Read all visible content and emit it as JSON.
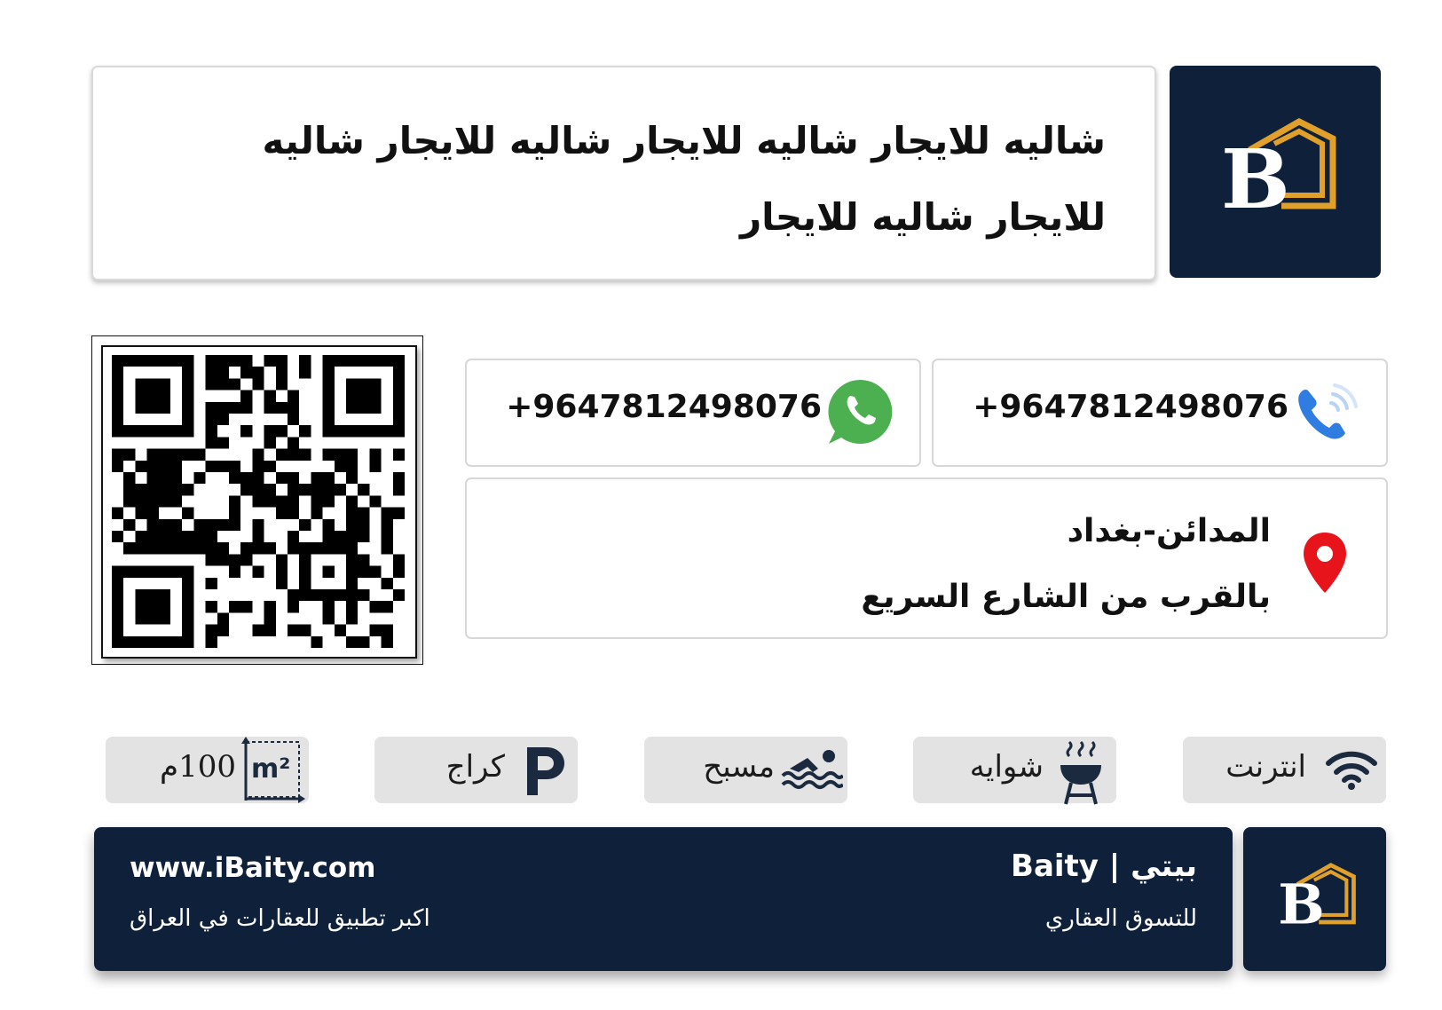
{
  "listing": {
    "title": "شاليه للايجار شاليه للايجار شاليه للايجار شاليه للايجار شاليه للايجار"
  },
  "contact": {
    "phone": "+9647812498076",
    "whatsapp": "+9647812498076"
  },
  "address": {
    "line1": "المدائن-بغداد",
    "line2": "بالقرب من الشارع السريع"
  },
  "features": {
    "area": "100م",
    "area_unit": "m²",
    "garage": "كراج",
    "pool": "مسبح",
    "grill": "شوايه",
    "internet": "انترنت"
  },
  "footer": {
    "brand": "Baity | بيتي",
    "tagline": "للتسوق العقاري",
    "website": "www.iBaity.com",
    "slogan": "اكبر تطبيق للعقارات في العراق"
  },
  "logo": {
    "letter": "B"
  },
  "colors": {
    "navy": "#0f213a",
    "gold": "#e0a02a",
    "whatsapp_green": "#4caf50",
    "phone_blue": "#2f7de1",
    "pin_red": "#e8141c"
  },
  "icons": {
    "phone": "phone-ringing-icon",
    "whatsapp": "whatsapp-icon",
    "location": "map-pin-icon",
    "area": "area-m2-icon",
    "garage": "parking-icon",
    "pool": "swimming-icon",
    "grill": "bbq-grill-icon",
    "internet": "wifi-icon"
  }
}
